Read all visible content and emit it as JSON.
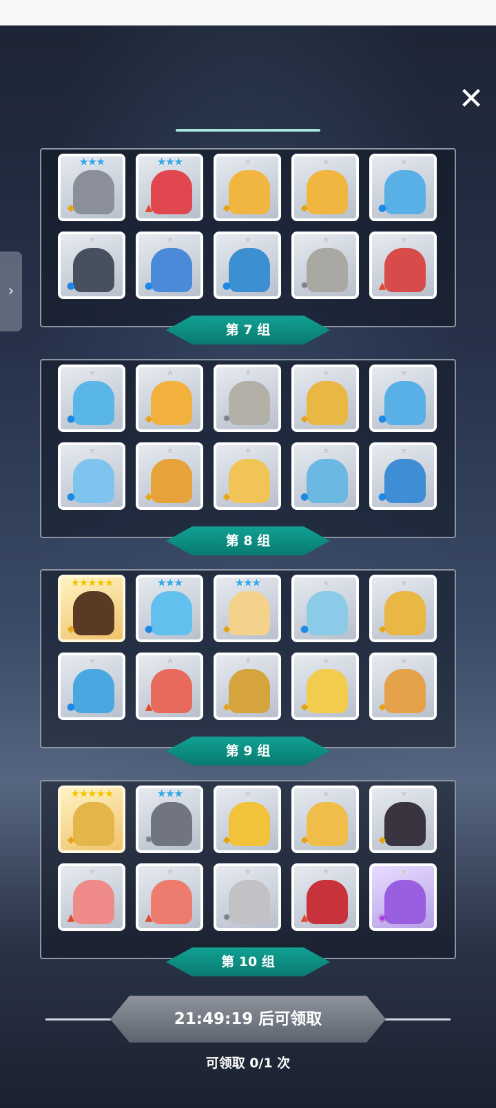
{
  "ui": {
    "close_icon": "close-icon",
    "side_arrow_icon": "chevron-right-icon",
    "claim_button_text": "21:49:19 后可领取",
    "claim_count_text": "可领取 0/1 次"
  },
  "groups": [
    {
      "label": "第 7 组",
      "heroes": [
        {
          "stars": 3,
          "star_color": "blue",
          "element": "light",
          "color": "#8a8f99"
        },
        {
          "stars": 3,
          "star_color": "blue",
          "element": "fire",
          "color": "#e0474e"
        },
        {
          "stars": 1,
          "star_color": "gray",
          "element": "light",
          "color": "#f0b63f"
        },
        {
          "stars": 1,
          "star_color": "gray",
          "element": "light",
          "color": "#f0b63f"
        },
        {
          "stars": 1,
          "star_color": "gray",
          "element": "water",
          "color": "#58b0e6"
        },
        {
          "stars": 1,
          "star_color": "gray",
          "element": "water",
          "color": "#46505e"
        },
        {
          "stars": 1,
          "star_color": "gray",
          "element": "water",
          "color": "#4a8ad8"
        },
        {
          "stars": 1,
          "star_color": "gray",
          "element": "water",
          "color": "#3c8fd0"
        },
        {
          "stars": 1,
          "star_color": "gray",
          "element": "gear",
          "color": "#a9a8a2"
        },
        {
          "stars": 1,
          "star_color": "gray",
          "element": "fire",
          "color": "#d84b4b"
        }
      ]
    },
    {
      "label": "第 8 组",
      "heroes": [
        {
          "stars": 1,
          "star_color": "gray",
          "element": "water",
          "color": "#5ab6e8"
        },
        {
          "stars": 1,
          "star_color": "gray",
          "element": "light",
          "color": "#f2b13c"
        },
        {
          "stars": 1,
          "star_color": "gray",
          "element": "gear",
          "color": "#b3b0a8"
        },
        {
          "stars": 1,
          "star_color": "gray",
          "element": "light",
          "color": "#e8b744"
        },
        {
          "stars": 1,
          "star_color": "gray",
          "element": "water",
          "color": "#58b0e6"
        },
        {
          "stars": 1,
          "star_color": "gray",
          "element": "water",
          "color": "#7fc4ee"
        },
        {
          "stars": 1,
          "star_color": "gray",
          "element": "light",
          "color": "#e5a33a"
        },
        {
          "stars": 1,
          "star_color": "gray",
          "element": "light",
          "color": "#f0c456"
        },
        {
          "stars": 1,
          "star_color": "gray",
          "element": "water",
          "color": "#6bb8e2"
        },
        {
          "stars": 1,
          "star_color": "gray",
          "element": "water",
          "color": "#3f8dd4"
        }
      ]
    },
    {
      "label": "第 9 组",
      "heroes": [
        {
          "stars": 5,
          "star_color": "gold",
          "element": "light",
          "color": "#5a3a24",
          "gold": true
        },
        {
          "stars": 3,
          "star_color": "blue",
          "element": "water",
          "color": "#62c0ee"
        },
        {
          "stars": 3,
          "star_color": "blue",
          "element": "light",
          "color": "#f4d28c"
        },
        {
          "stars": 1,
          "star_color": "gray",
          "element": "water",
          "color": "#8ccbe8"
        },
        {
          "stars": 1,
          "star_color": "gray",
          "element": "light",
          "color": "#e8b744"
        },
        {
          "stars": 1,
          "star_color": "gray",
          "element": "water",
          "color": "#4aa8e0"
        },
        {
          "stars": 1,
          "star_color": "gray",
          "element": "fire",
          "color": "#e86a5c"
        },
        {
          "stars": 1,
          "star_color": "gray",
          "element": "light",
          "color": "#d6a43c"
        },
        {
          "stars": 1,
          "star_color": "gray",
          "element": "light",
          "color": "#f2cc4c"
        },
        {
          "stars": 1,
          "star_color": "gray",
          "element": "light",
          "color": "#e6a24a"
        }
      ]
    },
    {
      "label": "第 10 组",
      "heroes": [
        {
          "stars": 5,
          "star_color": "gold",
          "element": "light",
          "color": "#e4b64a",
          "gold": true
        },
        {
          "stars": 3,
          "star_color": "blue",
          "element": "gear",
          "color": "#707580"
        },
        {
          "stars": 1,
          "star_color": "gray",
          "element": "light",
          "color": "#f2c23a"
        },
        {
          "stars": 1,
          "star_color": "gray",
          "element": "light",
          "color": "#f0bd4a"
        },
        {
          "stars": 1,
          "star_color": "gray",
          "element": "light",
          "color": "#3a3340"
        },
        {
          "stars": 1,
          "star_color": "gray",
          "element": "fire",
          "color": "#ee8a88"
        },
        {
          "stars": 1,
          "star_color": "gray",
          "element": "fire",
          "color": "#ee7c6e"
        },
        {
          "stars": 1,
          "star_color": "gray",
          "element": "gear",
          "color": "#c2c2c6"
        },
        {
          "stars": 1,
          "star_color": "gray",
          "element": "fire",
          "color": "#c8323a"
        },
        {
          "stars": 1,
          "star_color": "gray",
          "element": "dark",
          "color": "#9a5ee0",
          "purple": true
        }
      ]
    }
  ],
  "colors": {
    "ribbon": "#0f9486",
    "star_gold": "#f5c400",
    "star_blue": "#35a6e6",
    "star_gray": "#c9ced6",
    "elem_water": "#1e88e5",
    "elem_fire": "#e04a2a",
    "elem_light": "#e6a316",
    "elem_gear": "#7a7f88",
    "elem_dark": "#b03bd6"
  }
}
